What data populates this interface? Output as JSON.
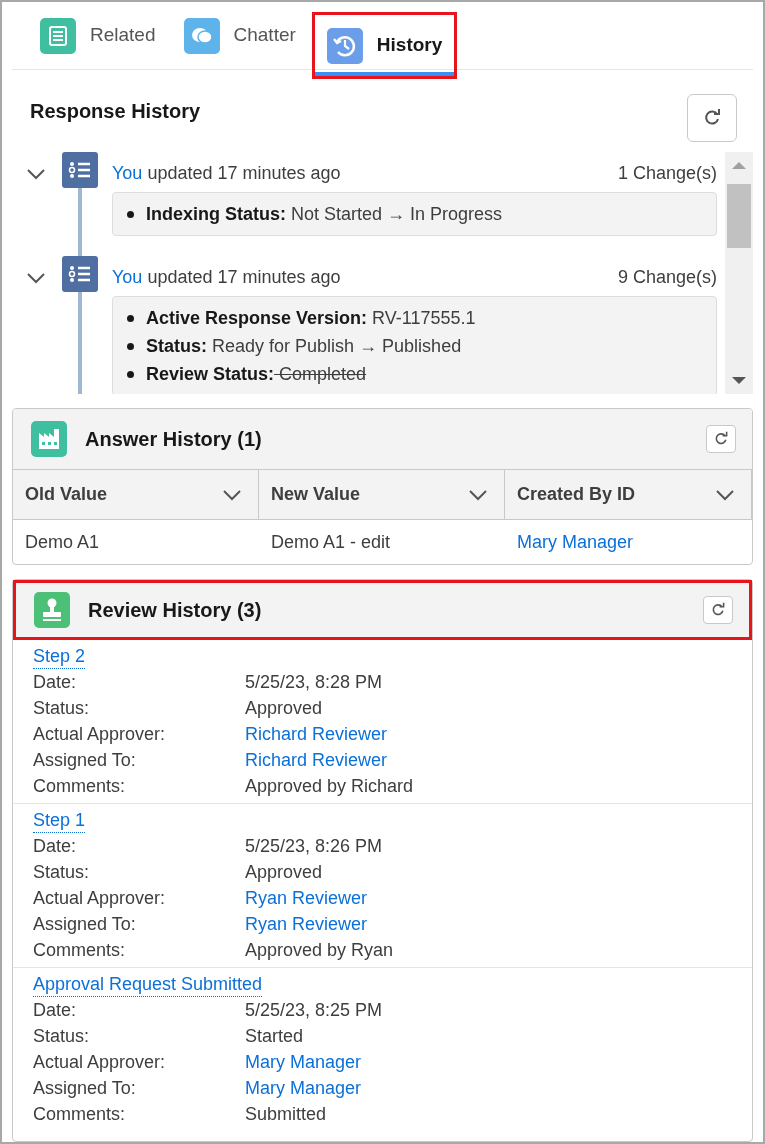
{
  "tabs": [
    {
      "label": "Related",
      "kind": "related",
      "selected": false,
      "highlighted": false
    },
    {
      "label": "Chatter",
      "kind": "chatter",
      "selected": false,
      "highlighted": false
    },
    {
      "label": "History",
      "kind": "history",
      "selected": true,
      "highlighted": true
    }
  ],
  "response_history": {
    "title": "Response History",
    "entries": [
      {
        "actor": "You",
        "action": "updated 17 minutes ago",
        "count": "1 Change(s)",
        "expanded": true,
        "changes": [
          {
            "label": "Indexing Status:",
            "value": "Not Started → In Progress",
            "struck": false
          }
        ]
      },
      {
        "actor": "You",
        "action": "updated 17 minutes ago",
        "count": "9 Change(s)",
        "expanded": true,
        "changes": [
          {
            "label": "Active Response Version:",
            "value": "RV-117555.1",
            "struck": false
          },
          {
            "label": "Status:",
            "value": "Ready for Publish → Published",
            "struck": false
          },
          {
            "label": "Review Status:",
            "value": "Completed",
            "struck": true
          }
        ]
      }
    ]
  },
  "answer_history": {
    "title": "Answer History (1)",
    "highlighted": false,
    "columns": [
      "Old Value",
      "New Value",
      "Created By ID"
    ],
    "rows": [
      [
        {
          "text": "Demo A1",
          "link": false
        },
        {
          "text": "Demo A1 - edit",
          "link": false
        },
        {
          "text": "Mary Manager",
          "link": true
        }
      ]
    ]
  },
  "review_history": {
    "title": "Review History (3)",
    "highlighted": true,
    "steps": [
      {
        "title": "Step 2",
        "fields": [
          {
            "label": "Date:",
            "value": "5/25/23, 8:28 PM",
            "link": false
          },
          {
            "label": "Status:",
            "value": "Approved",
            "link": false
          },
          {
            "label": "Actual Approver:",
            "value": "Richard Reviewer",
            "link": true
          },
          {
            "label": "Assigned To:",
            "value": "Richard Reviewer",
            "link": true
          },
          {
            "label": "Comments:",
            "value": "Approved by Richard",
            "link": false
          }
        ]
      },
      {
        "title": "Step 1",
        "fields": [
          {
            "label": "Date:",
            "value": "5/25/23, 8:26 PM",
            "link": false
          },
          {
            "label": "Status:",
            "value": "Approved",
            "link": false
          },
          {
            "label": "Actual Approver:",
            "value": "Ryan Reviewer",
            "link": true
          },
          {
            "label": "Assigned To:",
            "value": "Ryan Reviewer",
            "link": true
          },
          {
            "label": "Comments:",
            "value": "Approved by Ryan",
            "link": false
          }
        ]
      },
      {
        "title": "Approval Request Submitted",
        "fields": [
          {
            "label": "Date:",
            "value": "5/25/23, 8:25 PM",
            "link": false
          },
          {
            "label": "Status:",
            "value": "Started",
            "link": false
          },
          {
            "label": "Actual Approver:",
            "value": "Mary Manager",
            "link": true
          },
          {
            "label": "Assigned To:",
            "value": "Mary Manager",
            "link": true
          },
          {
            "label": "Comments:",
            "value": "Submitted",
            "link": false
          }
        ]
      }
    ]
  }
}
